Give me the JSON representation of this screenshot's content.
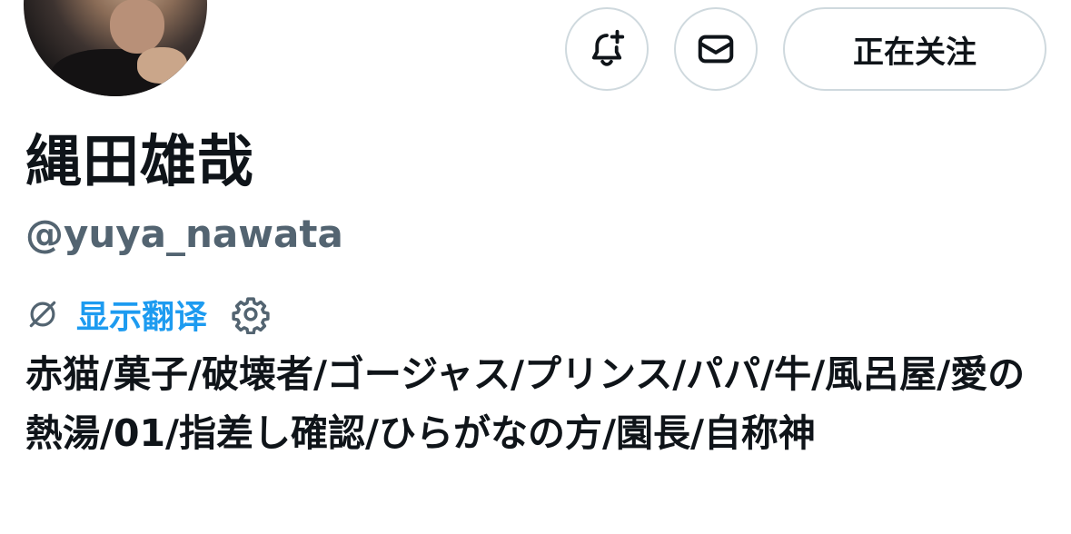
{
  "profile": {
    "display_name": "縄田雄哉",
    "handle": "@yuya_nawata",
    "bio": "赤猫/菓子/破壊者/ゴージャス/プリンス/パパ/牛/風呂屋/愛の熱湯/01/指差し確認/ひらがなの方/園長/自称神",
    "avatar_icon": "profile-photo"
  },
  "actions": {
    "notify_icon": "bell-plus-icon",
    "message_icon": "envelope-icon",
    "follow_label": "正在关注"
  },
  "translate": {
    "icon": "globe-slash-icon",
    "link_label": "显示翻译",
    "settings_icon": "gear-icon"
  },
  "colors": {
    "accent": "#1d9bf0",
    "secondary_text": "#536471",
    "border": "#cfd9de"
  }
}
